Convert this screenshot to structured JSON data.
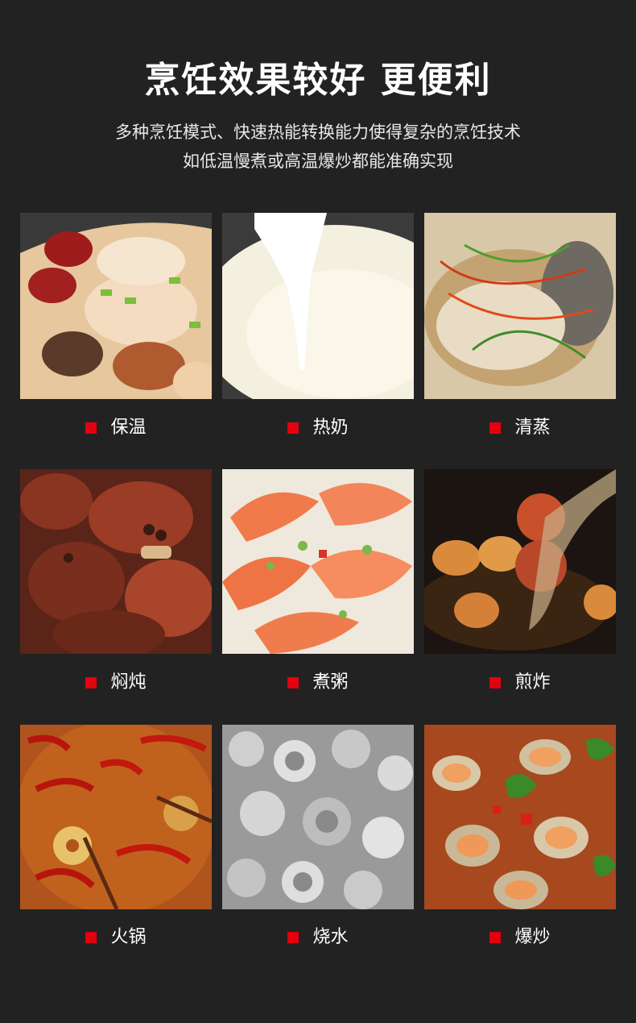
{
  "headline": "烹饪效果较好 更便利",
  "subtitle_line1": "多种烹饪模式、快速热能转换能力使得复杂的烹饪技术",
  "subtitle_line2": "如低温慢煮或高温爆炒都能准确实现",
  "accent_color": "#e3000f",
  "modes": [
    {
      "label": "保温",
      "image": "chicken-soup-photo"
    },
    {
      "label": "热奶",
      "image": "hot-milk-photo"
    },
    {
      "label": "清蒸",
      "image": "steamed-fish-photo"
    },
    {
      "label": "焖炖",
      "image": "braised-pork-trotters-photo"
    },
    {
      "label": "煮粥",
      "image": "shrimp-congee-photo"
    },
    {
      "label": "煎炸",
      "image": "fried-meatballs-photo"
    },
    {
      "label": "火锅",
      "image": "spicy-hotpot-photo"
    },
    {
      "label": "烧水",
      "image": "boiling-water-photo"
    },
    {
      "label": "爆炒",
      "image": "stir-fried-clams-photo"
    }
  ]
}
